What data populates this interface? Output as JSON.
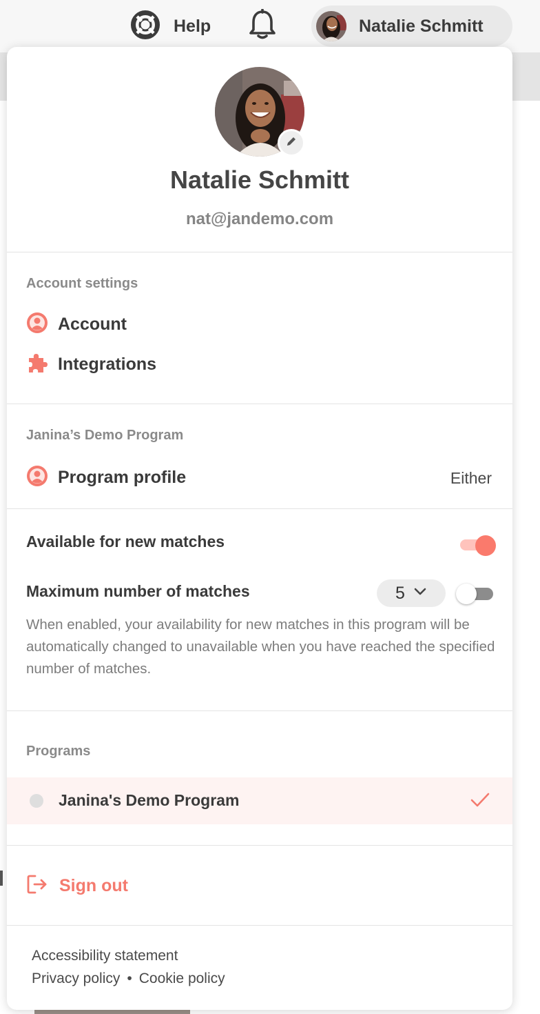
{
  "topbar": {
    "help_label": "Help",
    "user_name": "Natalie Schmitt"
  },
  "profile": {
    "name": "Natalie Schmitt",
    "email": "nat@jandemo.com"
  },
  "account_settings": {
    "heading": "Account settings",
    "items": [
      {
        "label": "Account",
        "icon": "account-icon"
      },
      {
        "label": "Integrations",
        "icon": "puzzle-icon"
      }
    ]
  },
  "program_section": {
    "heading": "Janina’s Demo Program",
    "profile_label": "Program profile",
    "profile_value": "Either"
  },
  "availability": {
    "available_label": "Available for new matches",
    "available_enabled": true,
    "max_label": "Maximum number of matches",
    "max_value": "5",
    "max_enabled": false,
    "description": "When enabled, your availability for new matches in this program will be automatically changed to unavailable when you have reached the specified number of matches."
  },
  "programs": {
    "heading": "Programs",
    "items": [
      {
        "name": "Janina's Demo Program",
        "selected": true
      }
    ]
  },
  "signout_label": "Sign out",
  "footer": {
    "accessibility": "Accessibility statement",
    "privacy": "Privacy policy",
    "separator": "•",
    "cookie": "Cookie policy"
  },
  "colors": {
    "accent": "#f47a6e",
    "toggle_track_on": "#ffc3bc",
    "selected_row_bg": "#fef3f2"
  }
}
